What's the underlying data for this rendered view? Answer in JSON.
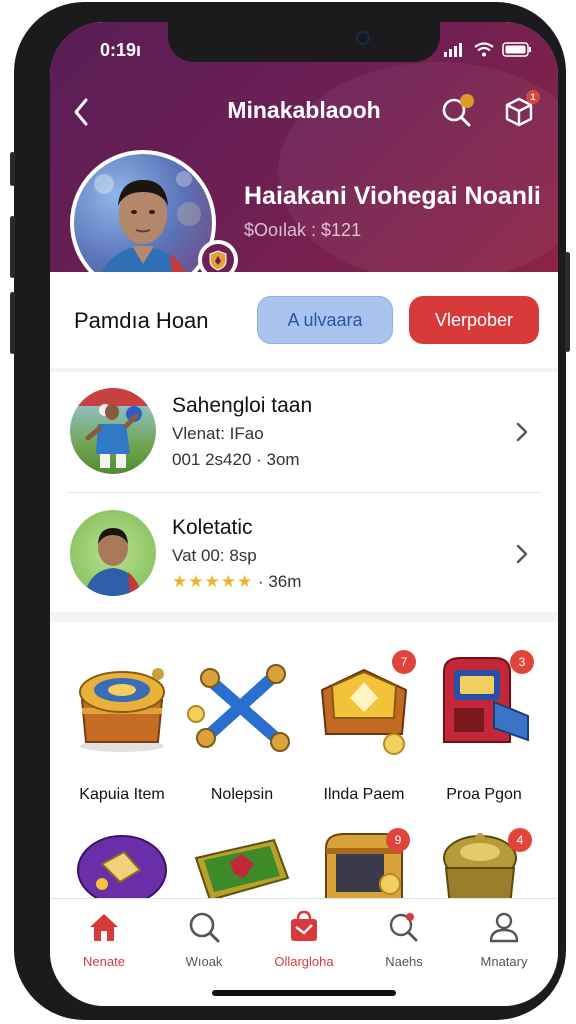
{
  "status": {
    "time": "0:19ı"
  },
  "header": {
    "title": "Minakablaooh",
    "box_badge": "1"
  },
  "profile": {
    "name": "Haiakani Viohegai Noanli",
    "subtitle": "$Ooılak : $121",
    "user_name": "Pamdıa Hoan",
    "btn_primary": "A ulvaara",
    "btn_secondary": "Vlerpober"
  },
  "list": [
    {
      "title": "Sahengloi taan",
      "line1": "Vlenat: IFao",
      "line2": "001 2s420 · 3om"
    },
    {
      "title": "Koletatic",
      "line1": "Vat 00: 8sp",
      "rating": "★★★★★",
      "line2": "· 36m"
    }
  ],
  "grid": [
    {
      "label": "Kapuia Item",
      "icon": "treasure-chest-icon",
      "badge": ""
    },
    {
      "label": "Nolepsin",
      "icon": "crossed-bones-icon",
      "badge": ""
    },
    {
      "label": "Ilnda Paem",
      "icon": "gold-shield-icon",
      "badge": "7"
    },
    {
      "label": "Proa Pgon",
      "icon": "arcade-machine-icon",
      "badge": "3"
    },
    {
      "label": "",
      "icon": "purple-orb-icon",
      "badge": ""
    },
    {
      "label": "",
      "icon": "green-tablet-icon",
      "badge": ""
    },
    {
      "label": "",
      "icon": "golden-chest-icon",
      "badge": "9"
    },
    {
      "label": "",
      "icon": "bronze-urn-icon",
      "badge": "4"
    }
  ],
  "tabs": [
    {
      "label": "Nenate",
      "icon": "home-icon",
      "active": true
    },
    {
      "label": "Wıoak",
      "icon": "search-lens-icon",
      "active": false
    },
    {
      "label": "Ollargloha",
      "icon": "gift-bag-icon",
      "active": false
    },
    {
      "label": "Naehs",
      "icon": "notification-search-icon",
      "active": false
    },
    {
      "label": "Mnatary",
      "icon": "profile-icon",
      "active": false
    }
  ],
  "colors": {
    "header_start": "#5a1d57",
    "header_end": "#8d2345",
    "accent_red": "#d83a3a",
    "accent_blue": "#a9c4ef",
    "star": "#f0b32a"
  }
}
